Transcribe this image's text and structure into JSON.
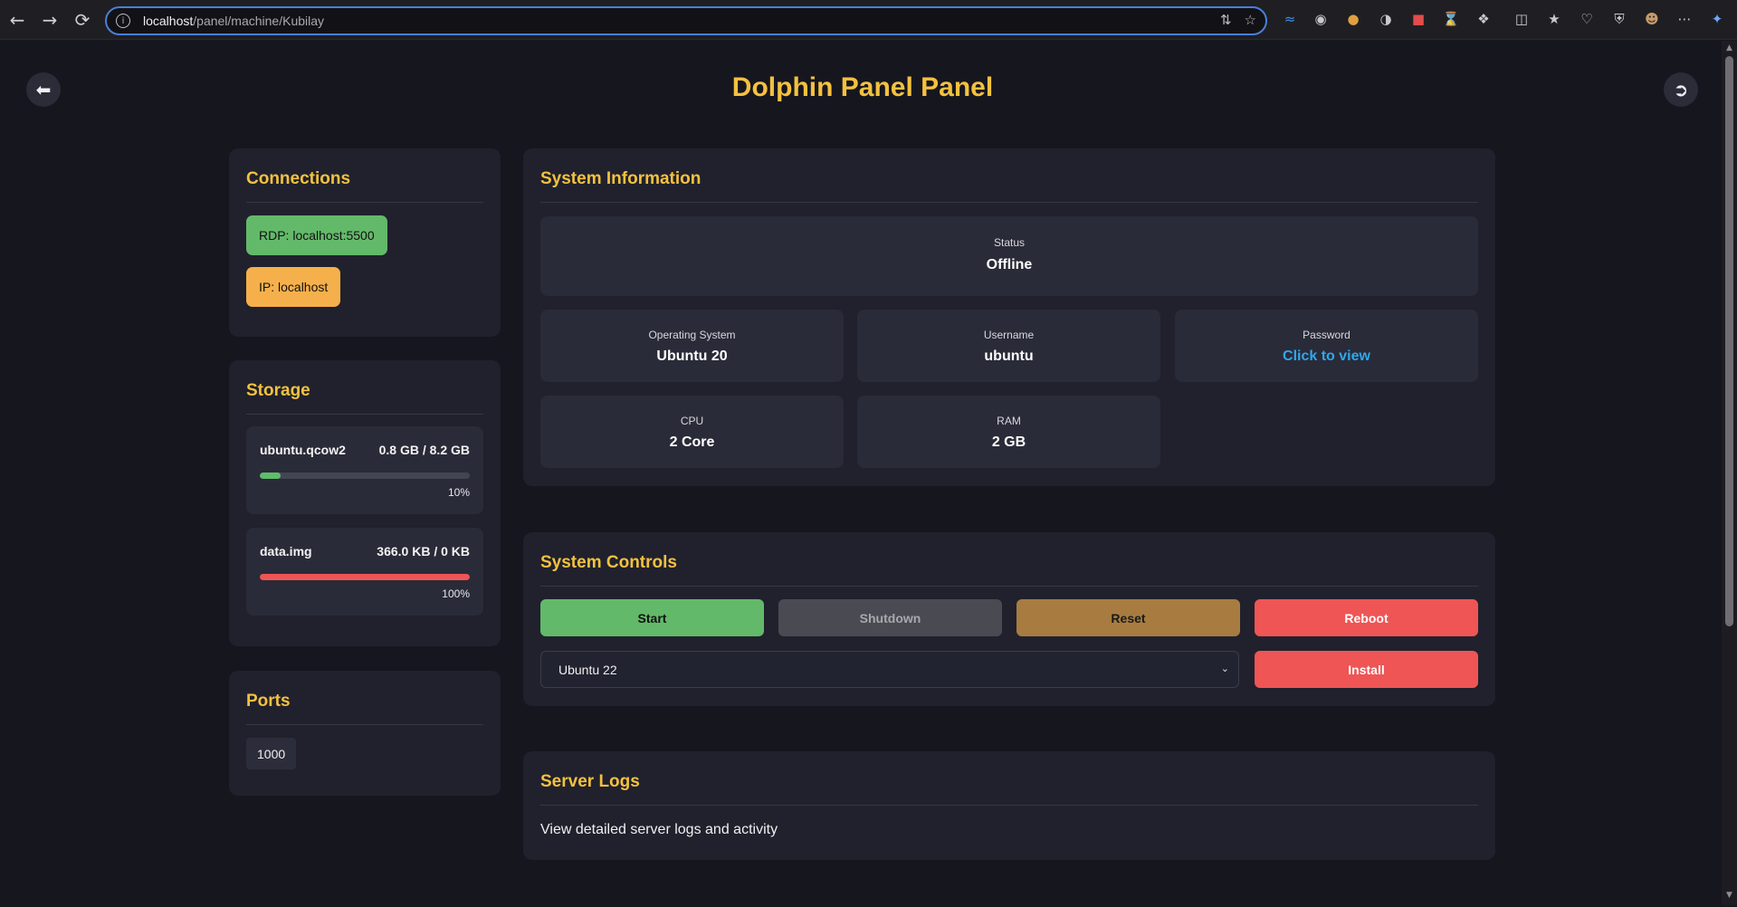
{
  "browser": {
    "url_host": "localhost",
    "url_path": "/panel/machine/Kubilay"
  },
  "page": {
    "title": "Dolphin Panel Panel"
  },
  "connections": {
    "title": "Connections",
    "rdp": "RDP: localhost:5500",
    "ip": "IP: localhost"
  },
  "storage": {
    "title": "Storage",
    "items": [
      {
        "name": "ubuntu.qcow2",
        "size": "0.8 GB / 8.2 GB",
        "percent_label": "10%",
        "percent": 10,
        "color": "#5fbd6a"
      },
      {
        "name": "data.img",
        "size": "366.0 KB / 0 KB",
        "percent_label": "100%",
        "percent": 100,
        "color": "#ef5555"
      }
    ]
  },
  "ports": {
    "title": "Ports",
    "items": [
      "1000"
    ]
  },
  "system_info": {
    "title": "System Information",
    "status_label": "Status",
    "status_value": "Offline",
    "os_label": "Operating System",
    "os_value": "Ubuntu 20",
    "username_label": "Username",
    "username_value": "ubuntu",
    "password_label": "Password",
    "password_value": "Click to view",
    "cpu_label": "CPU",
    "cpu_value": "2 Core",
    "ram_label": "RAM",
    "ram_value": "2 GB"
  },
  "controls": {
    "title": "System Controls",
    "start": "Start",
    "shutdown": "Shutdown",
    "reset": "Reset",
    "reboot": "Reboot",
    "os_select": "Ubuntu 22",
    "install": "Install"
  },
  "logs": {
    "title": "Server Logs",
    "description": "View detailed server logs and activity"
  },
  "colors": {
    "accent": "#f4c13f",
    "start": "#63b96a",
    "shutdown": "#4a4b52",
    "reset": "#a87c40",
    "danger": "#ef5555",
    "link": "#2ea8ee"
  }
}
